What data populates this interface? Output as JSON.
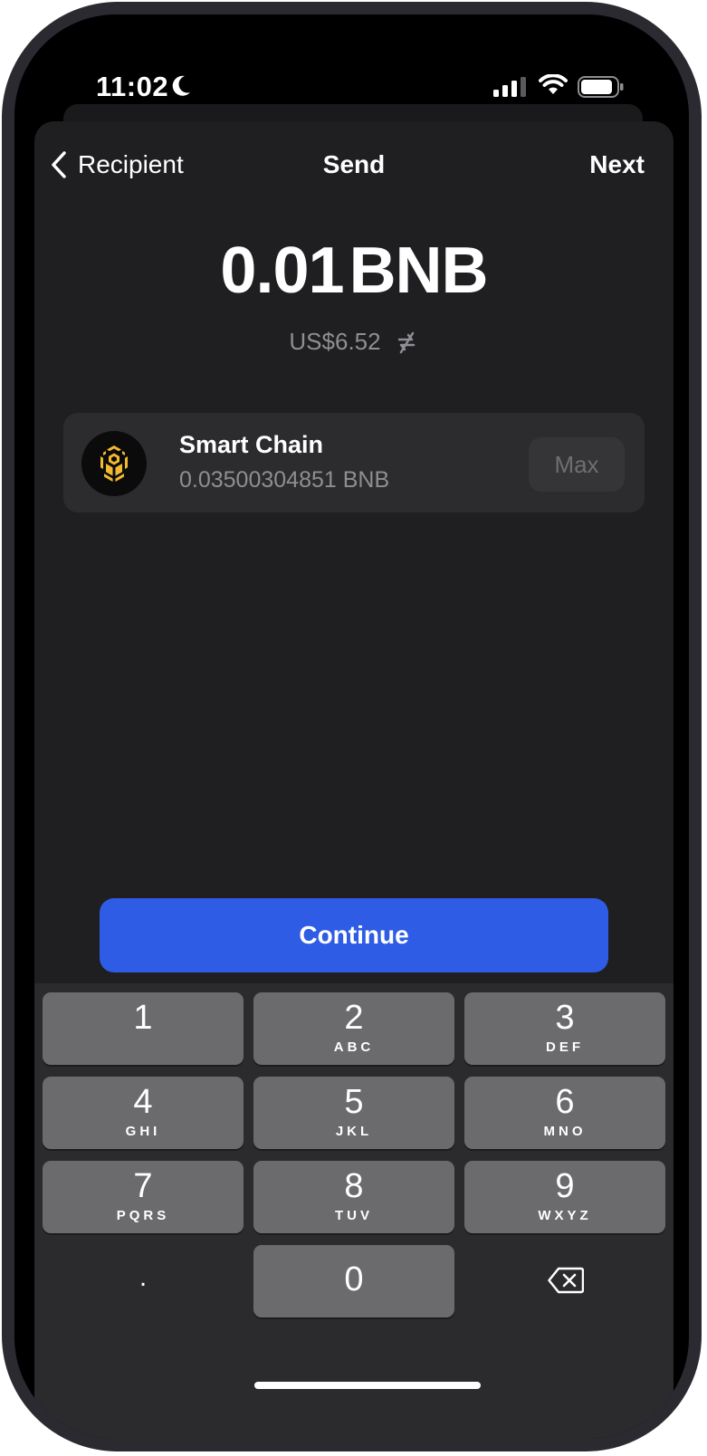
{
  "status_bar": {
    "time": "11:02",
    "focus_icon": "moon-icon",
    "signal_icon": "cellular-signal-icon",
    "wifi_icon": "wifi-icon",
    "battery_icon": "battery-icon"
  },
  "nav": {
    "back_label": "Recipient",
    "title": "Send",
    "next_label": "Next"
  },
  "amount": {
    "value": "0.01",
    "unit": "BNB",
    "fiat": "US$6.52",
    "swap_icon": "swap-currency-icon"
  },
  "asset": {
    "name": "Smart Chain",
    "balance": "0.03500304851 BNB",
    "logo_icon": "bnb-logo-icon",
    "logo_color": "#F3BA2F",
    "max_label": "Max"
  },
  "continue_label": "Continue",
  "accent_color": "#2F5CE5",
  "keypad": {
    "keys": [
      {
        "digit": "1",
        "letters": ""
      },
      {
        "digit": "2",
        "letters": "ABC"
      },
      {
        "digit": "3",
        "letters": "DEF"
      },
      {
        "digit": "4",
        "letters": "GHI"
      },
      {
        "digit": "5",
        "letters": "JKL"
      },
      {
        "digit": "6",
        "letters": "MNO"
      },
      {
        "digit": "7",
        "letters": "PQRS"
      },
      {
        "digit": "8",
        "letters": "TUV"
      },
      {
        "digit": "9",
        "letters": "WXYZ"
      }
    ],
    "dot": ".",
    "zero": "0",
    "delete_icon": "backspace-icon"
  }
}
